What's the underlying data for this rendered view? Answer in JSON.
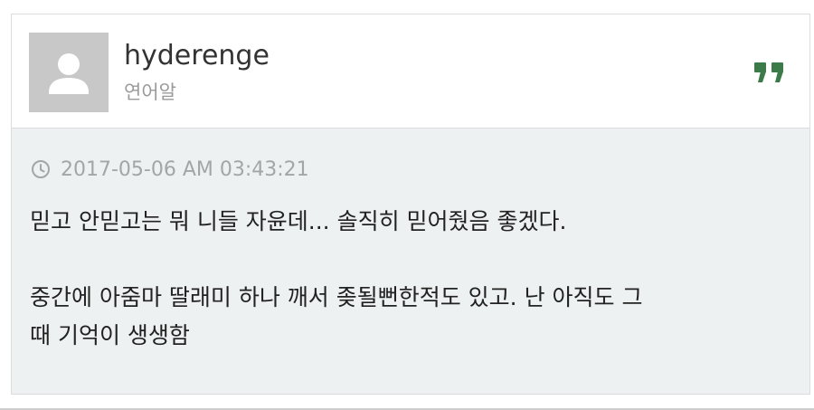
{
  "post": {
    "author": {
      "username": "hyderenge",
      "title": "연어알"
    },
    "timestamp": "2017-05-06 AM 03:43:21",
    "content": {
      "line1": "믿고 안믿고는 뭐 니들 자윤데... 솔직히 믿어줬음 좋겠다.",
      "line2": "중간에 아줌마 딸래미 하나 깨서 좆될뻔한적도 있고. 난 아직도 그",
      "line3": "때 기억이 생생함"
    },
    "icons": {
      "avatar": "user-placeholder-icon",
      "quote": "quote-icon",
      "clock": "clock-icon"
    },
    "colors": {
      "quote_accent": "#3d7a4a",
      "body_background": "#eef1f1",
      "avatar_background": "#c8c8c8"
    }
  }
}
